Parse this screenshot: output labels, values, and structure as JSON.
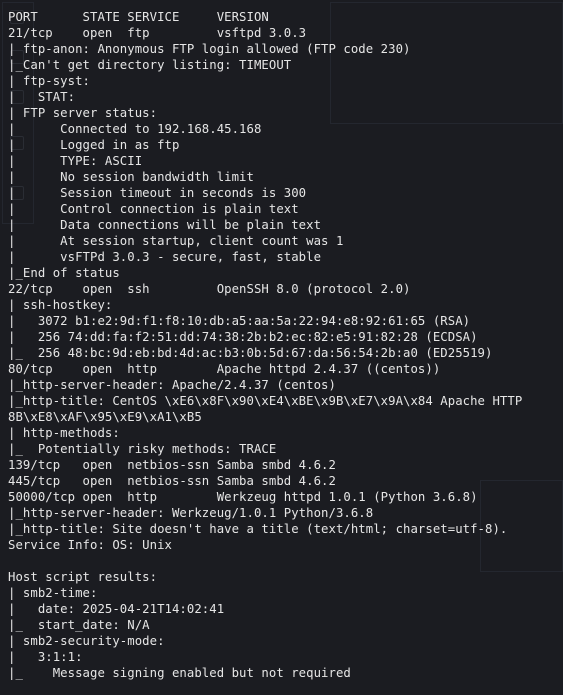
{
  "terminal": {
    "lines": [
      "PORT      STATE SERVICE     VERSION",
      "21/tcp    open  ftp         vsftpd 3.0.3",
      "| ftp-anon: Anonymous FTP login allowed (FTP code 230)",
      "|_Can't get directory listing: TIMEOUT",
      "| ftp-syst:",
      "|   STAT:",
      "| FTP server status:",
      "|      Connected to 192.168.45.168",
      "|      Logged in as ftp",
      "|      TYPE: ASCII",
      "|      No session bandwidth limit",
      "|      Session timeout in seconds is 300",
      "|      Control connection is plain text",
      "|      Data connections will be plain text",
      "|      At session startup, client count was 1",
      "|      vsFTPd 3.0.3 - secure, fast, stable",
      "|_End of status",
      "22/tcp    open  ssh         OpenSSH 8.0 (protocol 2.0)",
      "| ssh-hostkey:",
      "|   3072 b1:e2:9d:f1:f8:10:db:a5:aa:5a:22:94:e8:92:61:65 (RSA)",
      "|   256 74:dd:fa:f2:51:dd:74:38:2b:b2:ec:82:e5:91:82:28 (ECDSA)",
      "|_  256 48:bc:9d:eb:bd:4d:ac:b3:0b:5d:67:da:56:54:2b:a0 (ED25519)",
      "80/tcp    open  http        Apache httpd 2.4.37 ((centos))",
      "|_http-server-header: Apache/2.4.37 (centos)",
      "|_http-title: CentOS \\xE6\\x8F\\x90\\xE4\\xBE\\x9B\\xE7\\x9A\\x84 Apache HTTP",
      "8B\\xE8\\xAF\\x95\\xE9\\xA1\\xB5",
      "| http-methods:",
      "|_  Potentially risky methods: TRACE",
      "139/tcp   open  netbios-ssn Samba smbd 4.6.2",
      "445/tcp   open  netbios-ssn Samba smbd 4.6.2",
      "50000/tcp open  http        Werkzeug httpd 1.0.1 (Python 3.6.8)",
      "|_http-server-header: Werkzeug/1.0.1 Python/3.6.8",
      "|_http-title: Site doesn't have a title (text/html; charset=utf-8).",
      "Service Info: OS: Unix",
      "",
      "Host script results:",
      "| smb2-time:",
      "|   date: 2025-04-21T14:02:41",
      "|_  start_date: N/A",
      "| smb2-security-mode:",
      "|   3:1:1:",
      "|_    Message signing enabled but not required"
    ]
  },
  "colors": {
    "background": "#1b1c21",
    "text": "#e6e6e6",
    "ghost_text": "#3b3f4a"
  }
}
